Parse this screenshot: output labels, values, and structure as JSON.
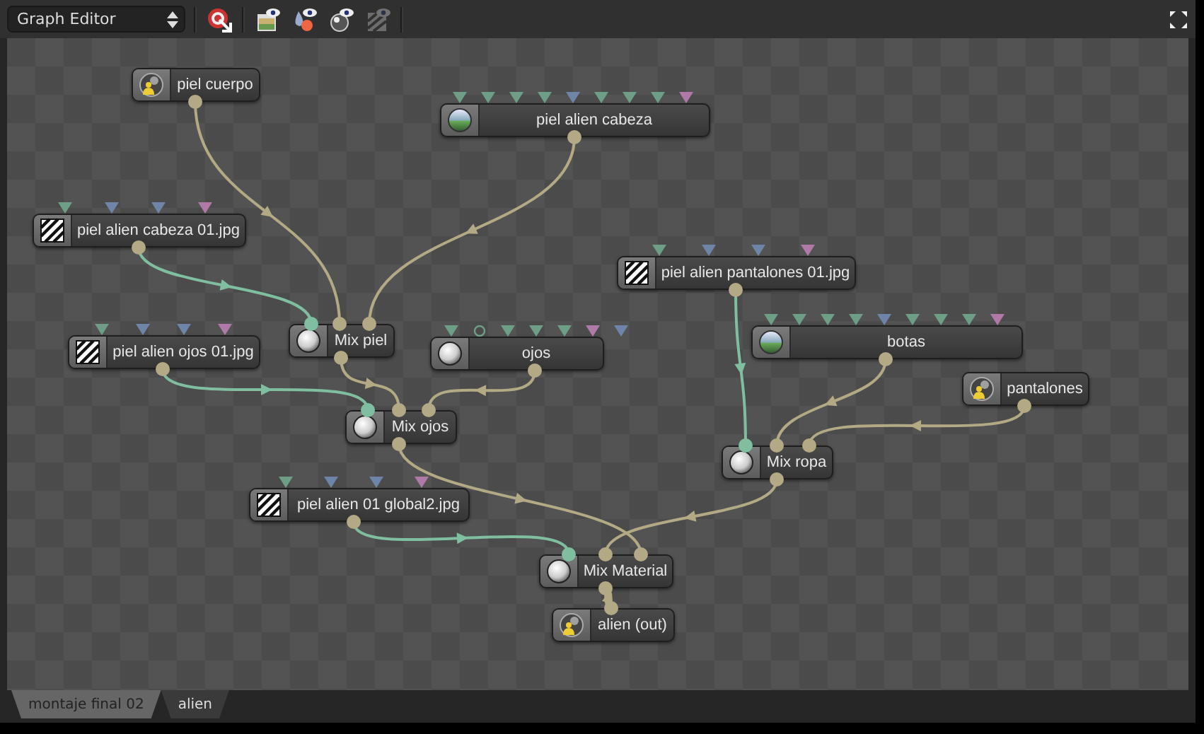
{
  "toolbar": {
    "editor_menu": "Graph Editor",
    "tools": [
      {
        "kind": "unlink",
        "disabled": false
      },
      {
        "kind": "image-view",
        "disabled": false
      },
      {
        "kind": "drops-view",
        "disabled": false
      },
      {
        "kind": "sphere-view",
        "disabled": false
      },
      {
        "kind": "stripes-view",
        "disabled": true
      }
    ],
    "maximize": true
  },
  "nodes": [
    {
      "label": "piel cuerpo",
      "kind": "avatar"
    },
    {
      "label": "piel alien cabeza",
      "kind": "environment",
      "sockets": [
        {
          "kind": "color"
        },
        {
          "kind": "color"
        },
        {
          "kind": "color"
        },
        {
          "kind": "color"
        },
        {
          "kind": "vector"
        },
        {
          "kind": "color"
        },
        {
          "kind": "color"
        },
        {
          "kind": "color"
        },
        {
          "kind": "shader"
        }
      ]
    },
    {
      "label": "piel alien cabeza 01.jpg",
      "kind": "image",
      "sockets": [
        {
          "kind": "color"
        },
        {
          "kind": "vector"
        },
        {
          "kind": "vector"
        },
        {
          "kind": "shader"
        }
      ]
    },
    {
      "label": "piel alien pantalones 01.jpg",
      "kind": "image",
      "sockets": [
        {
          "kind": "color"
        },
        {
          "kind": "vector"
        },
        {
          "kind": "vector"
        },
        {
          "kind": "shader"
        }
      ]
    },
    {
      "label": "Mix piel",
      "kind": "sphere",
      "inputs": [
        {
          "kind": "texture"
        },
        {
          "kind": "material"
        },
        {
          "kind": "material"
        }
      ]
    },
    {
      "label": "ojos",
      "kind": "sphere",
      "sockets": [
        {
          "kind": "color"
        },
        {
          "kind": "empty"
        },
        {
          "kind": "color"
        },
        {
          "kind": "color"
        },
        {
          "kind": "color"
        },
        {
          "kind": "shader"
        },
        {
          "kind": "vector"
        }
      ]
    },
    {
      "label": "piel alien ojos 01.jpg",
      "kind": "image",
      "sockets": [
        {
          "kind": "color"
        },
        {
          "kind": "vector"
        },
        {
          "kind": "vector"
        },
        {
          "kind": "shader"
        }
      ]
    },
    {
      "label": "botas",
      "kind": "environment",
      "sockets": [
        {
          "kind": "color"
        },
        {
          "kind": "color"
        },
        {
          "kind": "color"
        },
        {
          "kind": "color"
        },
        {
          "kind": "vector"
        },
        {
          "kind": "color"
        },
        {
          "kind": "color"
        },
        {
          "kind": "color"
        },
        {
          "kind": "shader"
        }
      ]
    },
    {
      "label": "pantalones",
      "kind": "avatar"
    },
    {
      "label": "Mix ojos",
      "kind": "sphere",
      "inputs": [
        {
          "kind": "texture"
        },
        {
          "kind": "material"
        },
        {
          "kind": "material"
        }
      ]
    },
    {
      "label": "Mix ropa",
      "kind": "sphere",
      "inputs": [
        {
          "kind": "texture"
        },
        {
          "kind": "material"
        },
        {
          "kind": "material"
        }
      ]
    },
    {
      "label": "piel alien 01 global2.jpg",
      "kind": "image",
      "sockets": [
        {
          "kind": "color"
        },
        {
          "kind": "vector"
        },
        {
          "kind": "vector"
        },
        {
          "kind": "shader"
        }
      ]
    },
    {
      "label": "Mix Material",
      "kind": "sphere",
      "inputs": [
        {
          "kind": "texture"
        },
        {
          "kind": "material"
        },
        {
          "kind": "material"
        }
      ]
    },
    {
      "label": "alien (out)",
      "kind": "avatar",
      "inputs": [
        {
          "kind": "material"
        }
      ]
    }
  ],
  "tabs": [
    {
      "label": "montaje final 02",
      "selected": false
    },
    {
      "label": "alien",
      "selected": true
    }
  ]
}
